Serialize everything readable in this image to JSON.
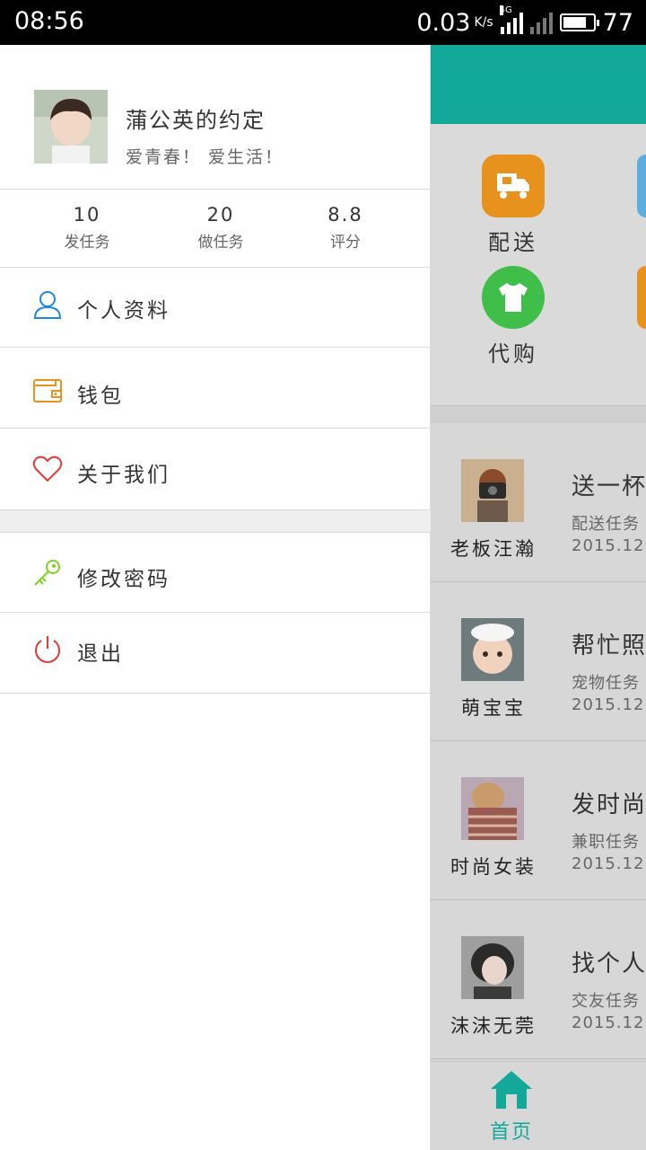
{
  "status_bar": {
    "time": "08:56",
    "speed": "0.03",
    "speed_unit": "K/s",
    "network": "4G",
    "battery": "77"
  },
  "drawer": {
    "profile": {
      "name": "蒲公英的约定",
      "motto": "爱青春！ 爱生活！"
    },
    "stats": [
      {
        "value": "10",
        "label": "发任务"
      },
      {
        "value": "20",
        "label": "做任务"
      },
      {
        "value": "8.8",
        "label": "评分"
      }
    ],
    "menu": [
      {
        "label": "个人资料",
        "icon": "person-icon"
      },
      {
        "label": "钱包",
        "icon": "wallet-icon"
      },
      {
        "label": "关于我们",
        "icon": "heart-icon"
      },
      {
        "label": "修改密码",
        "icon": "key-icon"
      },
      {
        "label": "退出",
        "icon": "power-icon"
      }
    ]
  },
  "main": {
    "categories": [
      {
        "label": "配送",
        "icon": "delivery-truck-icon",
        "color": "#e8921e"
      },
      {
        "label": "代购",
        "icon": "tshirt-icon",
        "color": "#3fbf4a"
      }
    ],
    "tasks": [
      {
        "user": "老板汪瀚",
        "title": "送一杯",
        "type": "配送任务",
        "date": "2015.12."
      },
      {
        "user": "萌宝宝",
        "title": "帮忙照",
        "type": "宠物任务",
        "date": "2015.12."
      },
      {
        "user": "时尚女装",
        "title": "发时尚",
        "type": "兼职任务",
        "date": "2015.12."
      },
      {
        "user": "沫沫无莞",
        "title": "找个人",
        "type": "交友任务",
        "date": "2015.12."
      }
    ],
    "nav": {
      "home_label": "首页"
    }
  },
  "colors": {
    "accent": "#12a99a",
    "person_icon": "#1e88e5",
    "wallet_icon": "#e8921e",
    "heart_icon": "#e53935",
    "key_icon": "#7ed321",
    "power_icon": "#e53935"
  }
}
